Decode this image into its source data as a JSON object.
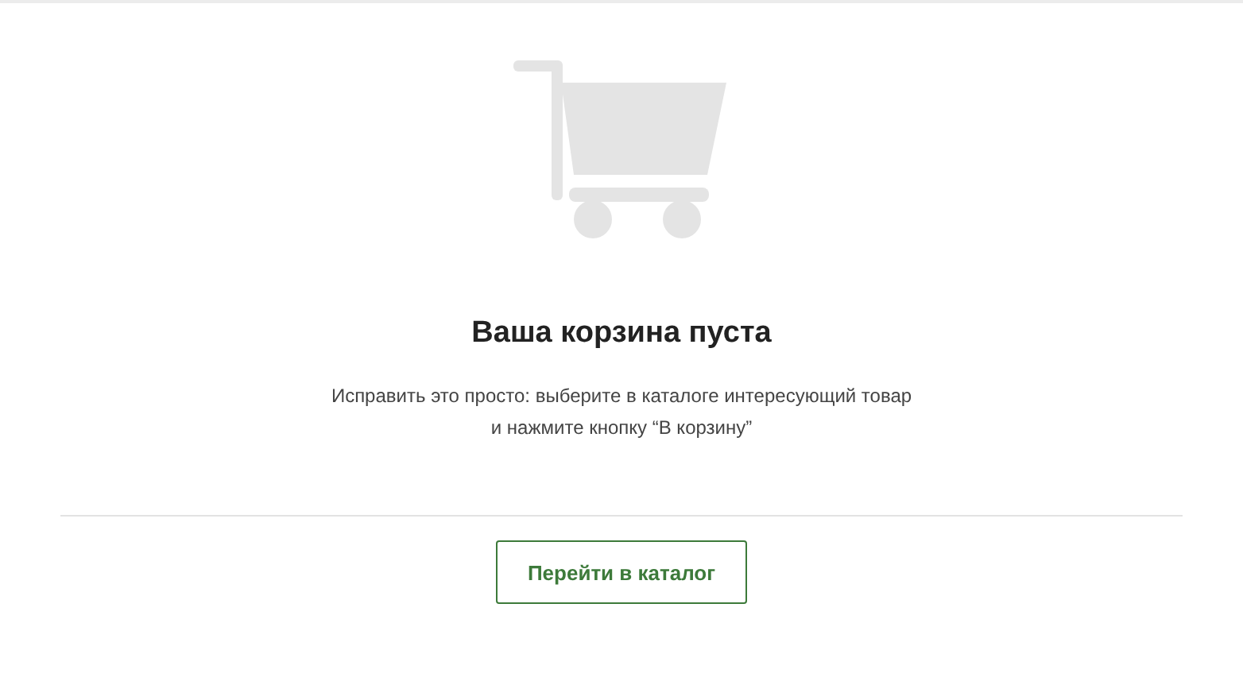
{
  "empty_cart": {
    "title": "Ваша корзина пуста",
    "message": "Исправить это просто: выберите в каталоге интересующий товар\nи нажмите кнопку “В корзину”",
    "button": "Перейти в каталог"
  }
}
